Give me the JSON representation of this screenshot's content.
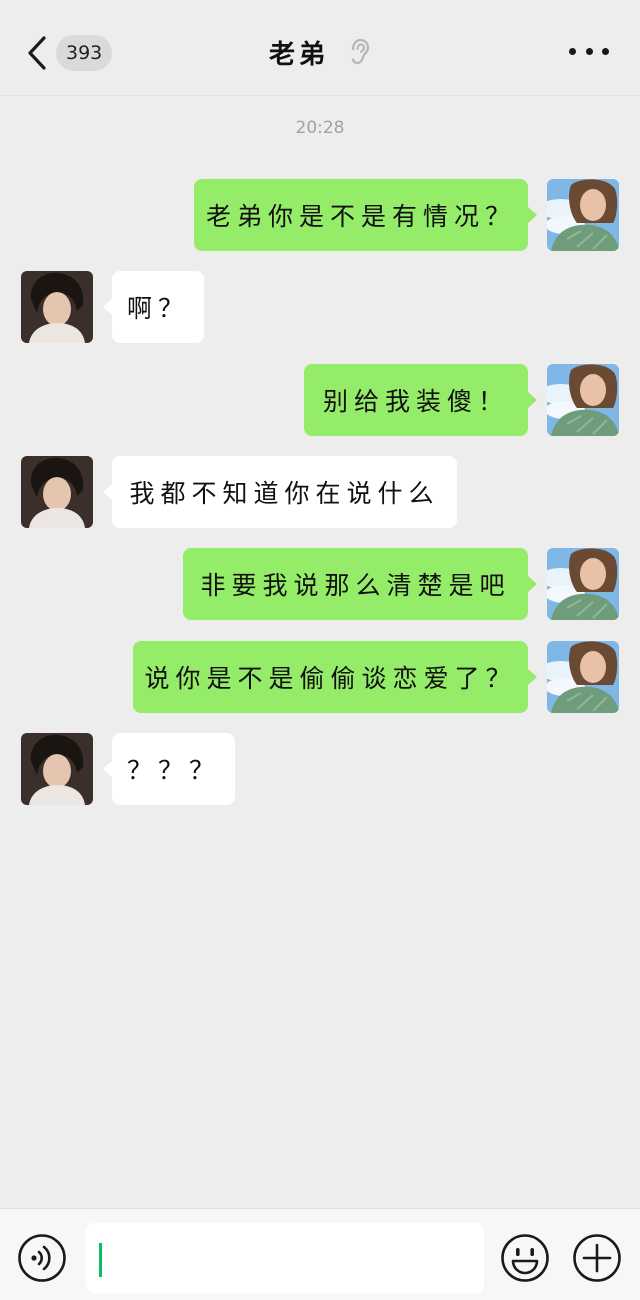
{
  "header": {
    "back_icon": "chevron-left-icon",
    "unread_count": "393",
    "title": "老弟",
    "mute_icon": "ear-icon",
    "more_icon": "more-dots-icon"
  },
  "timestamp": "20:28",
  "messages": [
    {
      "side": "right",
      "text": "老弟你是不是有情况？"
    },
    {
      "side": "left",
      "text": "啊？"
    },
    {
      "side": "right",
      "text": "别给我装傻！"
    },
    {
      "side": "left",
      "text": "我都不知道你在说什么"
    },
    {
      "side": "right",
      "text": "非要我说那么清楚是吧"
    },
    {
      "side": "right",
      "text": "说你是不是偷偷谈恋爱了？"
    },
    {
      "side": "left",
      "text": "？？？"
    }
  ],
  "input_bar": {
    "voice_icon": "voice-icon",
    "input_value": "",
    "emoji_icon": "emoji-icon",
    "plus_icon": "plus-icon"
  },
  "colors": {
    "background": "#ededed",
    "sent_bubble": "#95ec69",
    "received_bubble": "#ffffff",
    "caret": "#07c160"
  }
}
